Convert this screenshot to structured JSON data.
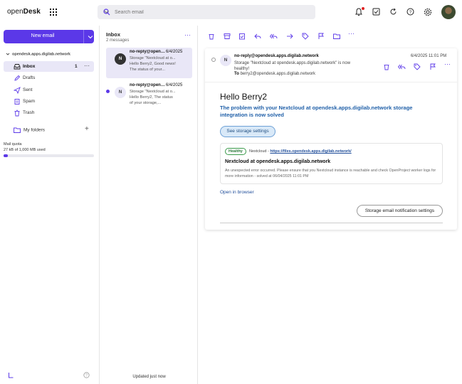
{
  "app": {
    "logo_prefix": "open",
    "logo_bold": "Desk"
  },
  "search": {
    "placeholder": "Search email"
  },
  "sidebar": {
    "new_email": "New email",
    "account": "opendesk.apps.digilab.network",
    "items": [
      {
        "label": "Inbox",
        "count": "1",
        "icon": "inbox-icon"
      },
      {
        "label": "Drafts",
        "icon": "pencil-icon"
      },
      {
        "label": "Sent",
        "icon": "send-icon"
      },
      {
        "label": "Spam",
        "icon": "spam-icon"
      },
      {
        "label": "Trash",
        "icon": "trash-icon"
      }
    ],
    "my_folders": "My folders",
    "quota_title": "Mail quota",
    "quota_value": "27 kB of 1,000 MB used",
    "quota_fraction": 0.05
  },
  "list": {
    "title": "Inbox",
    "count": "2 messages",
    "messages": [
      {
        "avatar": "N",
        "from": "no-reply@opendesk.apps.digilab.network",
        "date": "6/4/2025",
        "line1": "Storage \"Nextcloud at o...",
        "line2": "Hello Berry2, Good news!",
        "line3": "The status of your..."
      },
      {
        "avatar": "N",
        "from": "no-reply@opendesk.apps.digilab.network",
        "date": "6/4/2025",
        "line1": "Storage \"Nextcloud at o...",
        "line2": "Hello Berry2, The status",
        "line3": "of your storage,..."
      }
    ],
    "updated": "Updated just now"
  },
  "reader": {
    "from": "no-reply@opendesk.apps.digilab.network",
    "date": "6/4/2025 11:01 PM",
    "avatar": "N",
    "subject_line1": "Storage \"Nextcloud at opendesk.apps.digilab.network\" is now",
    "subject_line2": "healthy!",
    "to_label": "To",
    "to": "berry2@opendesk.apps.digilab.network",
    "hello": "Hello Berry2",
    "problem": "The problem with your Nextcloud at opendesk.apps.digilab.network storage integration is now solved",
    "see_button": "See storage settings",
    "healthy_badge": "Healthy",
    "source_prefix": "Nextcloud - ",
    "source_link": "https://files.opendesk.apps.digilab.network/",
    "box_title": "Nextcloud at opendesk.apps.digilab.network",
    "box_error": "An unexpected error occurred. Please ensure that you Nextcloud instance is reachable and check OpenProject worker logs for more information - solved at 06/04/2025 11:01 PM",
    "open_browser": "Open in browser",
    "store_button": "Storage email notification settings"
  },
  "colors": {
    "accent": "#5b38e8",
    "link": "#1f4d9a",
    "heading": "#1f5fa8",
    "healthy": "#3a9a4a"
  }
}
